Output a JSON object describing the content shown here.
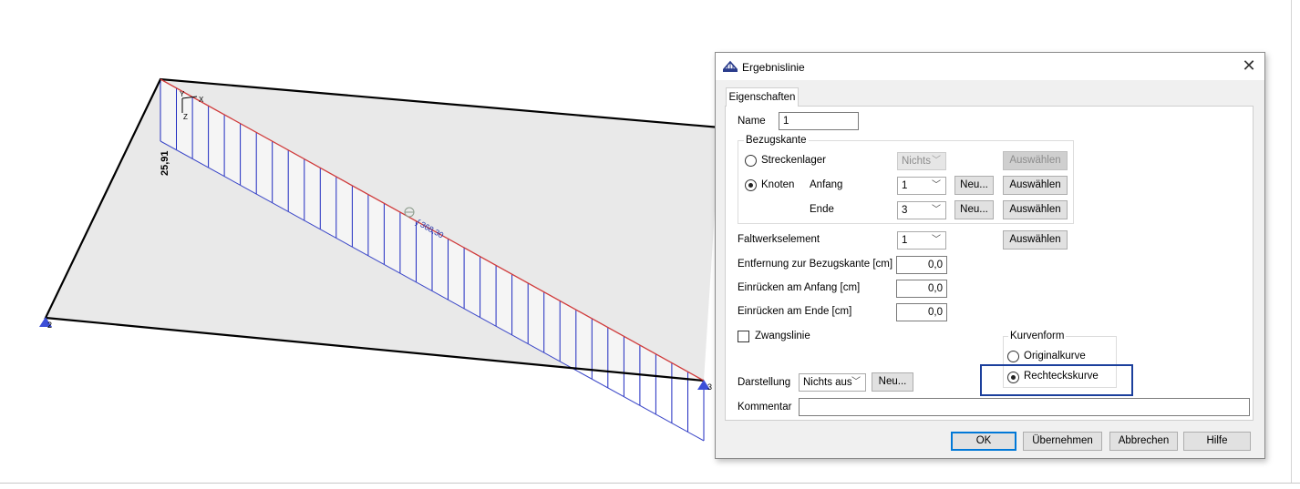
{
  "viewport": {
    "node_labels": [
      "2",
      "3"
    ],
    "diagram_labels": {
      "max_value": "25,91",
      "integral": "∫ 368,30"
    },
    "axis_labels": [
      "Y",
      "Z",
      "X"
    ],
    "colors": {
      "outline": "#000000",
      "fill": "#e9e9e9",
      "result_line": "#d03a3a",
      "hatch": "#1f2bc0",
      "node": "#3c4fd8"
    }
  },
  "dialog": {
    "title": "Ergebnislinie",
    "icon": "app-icon",
    "close_label": "✕",
    "tab": "Eigenschaften",
    "name": {
      "label": "Name",
      "value": "1"
    },
    "bezugskante": {
      "title": "Bezugskante",
      "streckenlager_label": "Streckenlager",
      "streckenlager_value": "Nichts",
      "knoten_label": "Knoten",
      "anfang_label": "Anfang",
      "anfang_value": "1",
      "ende_label": "Ende",
      "ende_value": "3",
      "select_label": "Auswählen",
      "new_label": "Neu..."
    },
    "faltwerkselement": {
      "label": "Faltwerkselement",
      "value": "1",
      "select_label": "Auswählen"
    },
    "fields": [
      {
        "label": "Entfernung zur Bezugskante [cm]",
        "value": "0,0"
      },
      {
        "label": "Einrücken am Anfang [cm]",
        "value": "0,0"
      },
      {
        "label": "Einrücken am Ende [cm]",
        "value": "0,0"
      }
    ],
    "zwangslinie_label": "Zwangslinie",
    "kurvenform": {
      "title": "Kurvenform",
      "options": [
        "Originalkurve",
        "Rechteckskurve"
      ],
      "selected": "Rechteckskurve"
    },
    "darstellung": {
      "label": "Darstellung",
      "value": "Nichts aus",
      "new_label": "Neu..."
    },
    "kommentar": {
      "label": "Kommentar",
      "value": ""
    },
    "buttons": {
      "ok": "OK",
      "apply": "Übernehmen",
      "cancel": "Abbrechen",
      "help": "Hilfe"
    }
  }
}
